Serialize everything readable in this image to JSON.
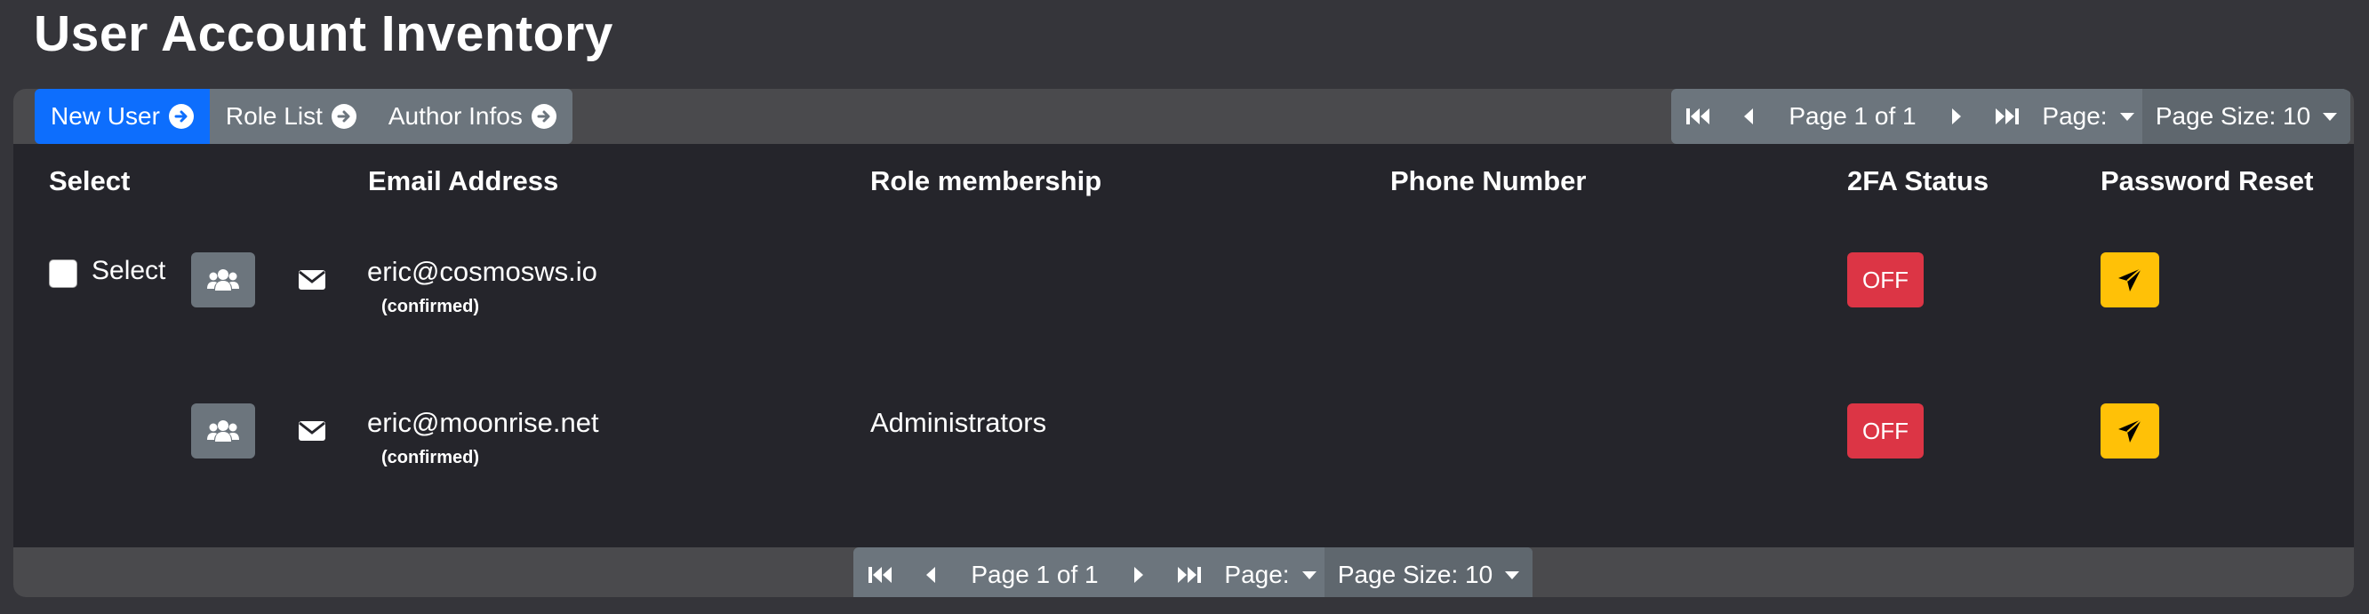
{
  "page": {
    "title": "User Account Inventory"
  },
  "toolbar": {
    "new_user": "New User",
    "role_list": "Role List",
    "author_infos": "Author Infos"
  },
  "pagination": {
    "page_info": "Page 1 of 1",
    "page_dropdown": "Page:",
    "page_size": "Page Size: 10"
  },
  "table": {
    "columns": {
      "select": "Select",
      "email": "Email Address",
      "role": "Role membership",
      "phone": "Phone Number",
      "twofa": "2FA Status",
      "password": "Password Reset"
    },
    "rows": [
      {
        "select_label": "Select",
        "email": "eric@cosmosws.io",
        "email_status": "(confirmed)",
        "role": "",
        "phone": "",
        "twofa": "OFF"
      },
      {
        "select_label": "",
        "email": "eric@moonrise.net",
        "email_status": "(confirmed)",
        "role": "Administrators",
        "phone": "",
        "twofa": "OFF"
      }
    ]
  },
  "colors": {
    "primary": "#0d6efd",
    "secondary": "#6c757d",
    "danger": "#dc3545",
    "warning": "#ffc107",
    "background": "#35353a",
    "table_bg": "#25252b"
  },
  "icons": [
    "arrow-right-circle-icon",
    "first-page-icon",
    "prev-page-icon",
    "next-page-icon",
    "last-page-icon",
    "caret-down-icon",
    "users-icon",
    "envelope-icon",
    "paper-plane-icon"
  ]
}
